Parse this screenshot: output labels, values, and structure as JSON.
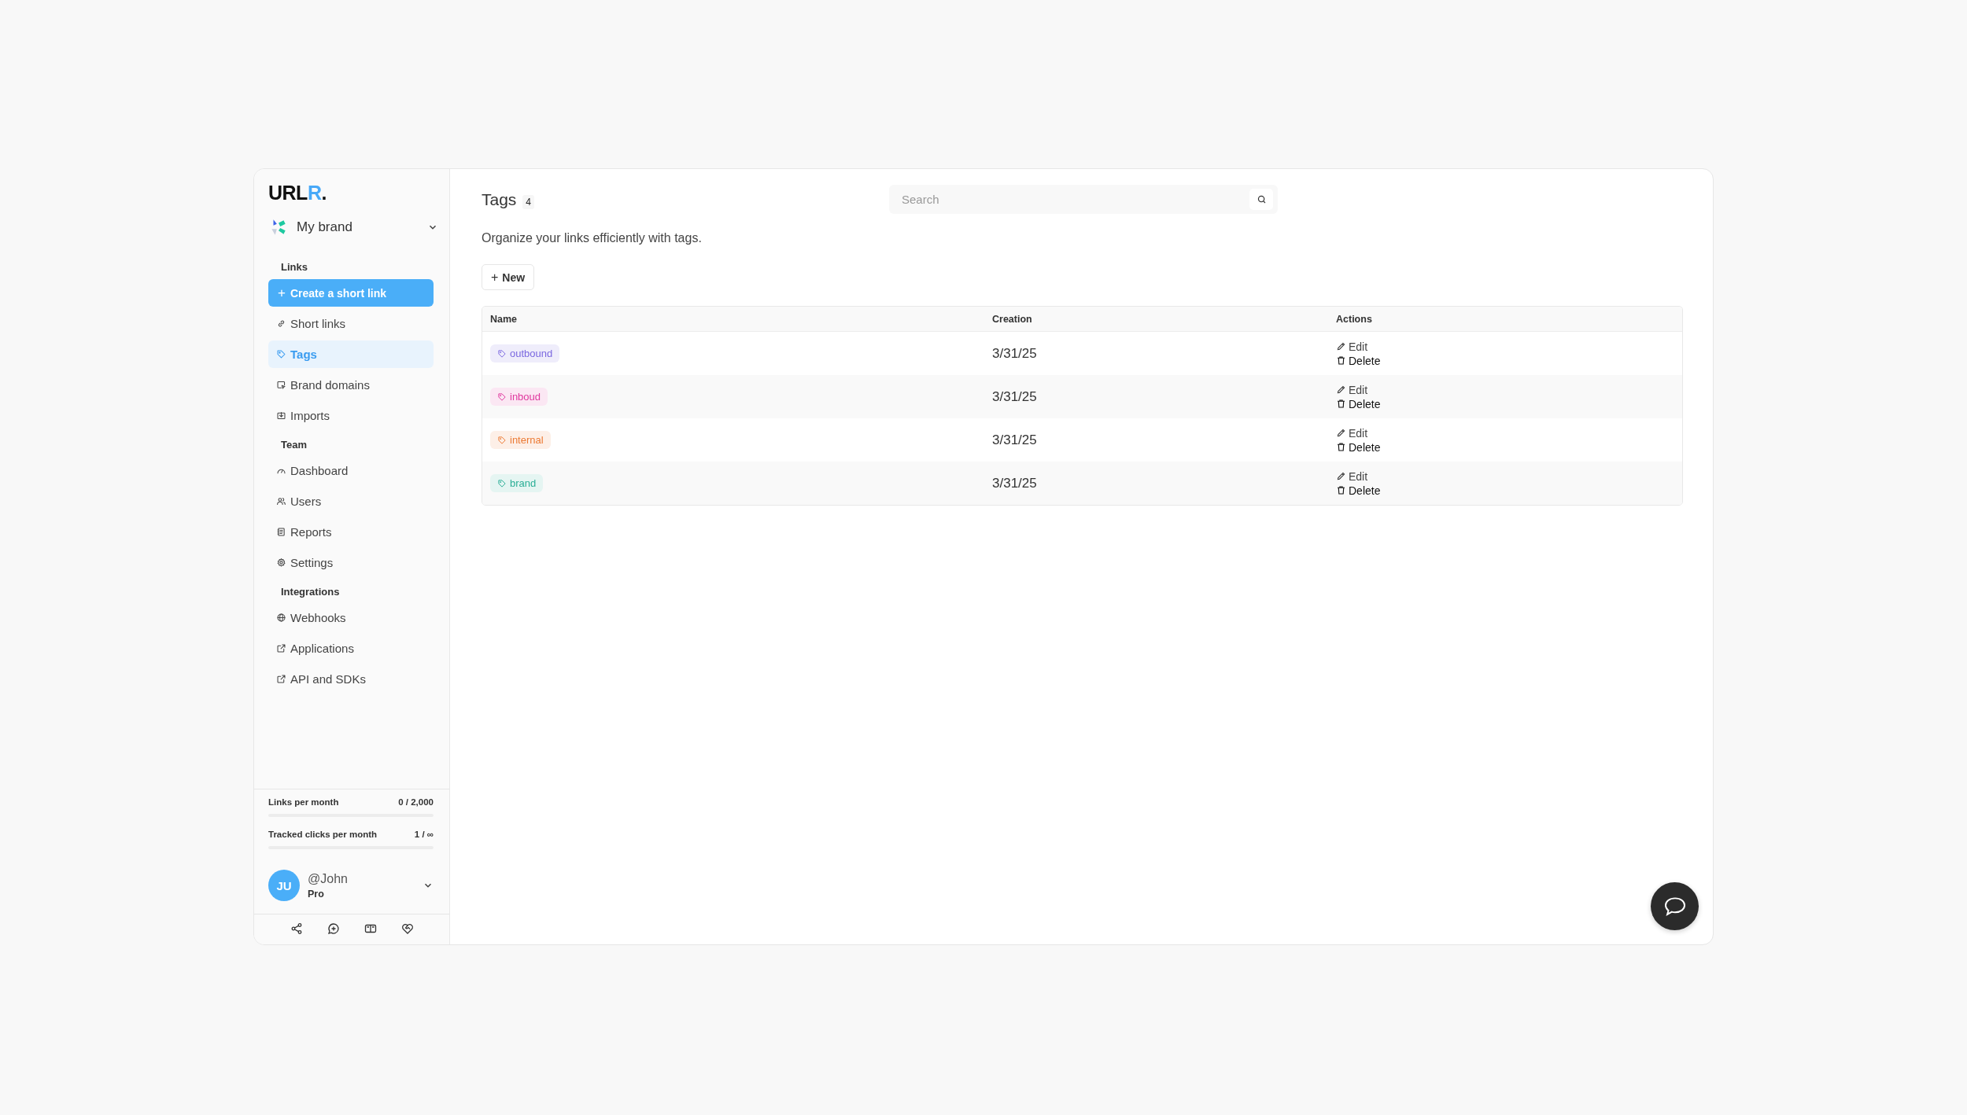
{
  "sidebar": {
    "logo": {
      "main": "URL",
      "accent": "R",
      "dot": "."
    },
    "workspace": {
      "name": "My brand"
    },
    "nav": [
      {
        "kind": "section",
        "label": "Links"
      },
      {
        "kind": "action",
        "label": "Create a short link",
        "icon_text": "+"
      },
      {
        "kind": "link",
        "label": "Short links",
        "selected": false
      },
      {
        "kind": "link",
        "label": "Tags",
        "selected": true
      },
      {
        "kind": "link",
        "label": "Brand domains",
        "selected": false
      },
      {
        "kind": "link",
        "label": "Imports",
        "selected": false
      },
      {
        "kind": "section",
        "label": "Team"
      },
      {
        "kind": "link",
        "label": "Dashboard",
        "selected": false
      },
      {
        "kind": "link",
        "label": "Users",
        "selected": false
      },
      {
        "kind": "link",
        "label": "Reports",
        "selected": false
      },
      {
        "kind": "link",
        "label": "Settings",
        "selected": false
      },
      {
        "kind": "section",
        "label": "Integrations"
      },
      {
        "kind": "link",
        "label": "Webhooks",
        "selected": false
      },
      {
        "kind": "link",
        "label": "Applications",
        "selected": false
      },
      {
        "kind": "link",
        "label": "API and SDKs",
        "selected": false
      }
    ],
    "usage": [
      {
        "label": "Links per month",
        "reading": "0 / 2,000",
        "level": 0
      },
      {
        "label": "Tracked clicks per month",
        "reading": "1 / ∞",
        "level": 0
      }
    ],
    "user": {
      "initials": "JU",
      "handle": "@John",
      "plan": "Pro"
    }
  },
  "main": {
    "title": "Tags",
    "count": "4",
    "search": {
      "placeholder": "Search"
    },
    "description": "Organize your links efficiently with tags.",
    "new_button": {
      "icon_text": "+",
      "label": "New"
    },
    "table": {
      "columns": [
        "Name",
        "Creation",
        "Actions"
      ],
      "rows": [
        {
          "name": "outbound",
          "color": "#7b68e0",
          "creation": "3/31/25",
          "edit": "Edit",
          "delete": "Delete"
        },
        {
          "name": "inboud",
          "color": "#e0389f",
          "creation": "3/31/25",
          "edit": "Edit",
          "delete": "Delete"
        },
        {
          "name": "internal",
          "color": "#ec7a34",
          "creation": "3/31/25",
          "edit": "Edit",
          "delete": "Delete"
        },
        {
          "name": "brand",
          "color": "#2aae96",
          "creation": "3/31/25",
          "edit": "Edit",
          "delete": "Delete"
        }
      ]
    }
  }
}
